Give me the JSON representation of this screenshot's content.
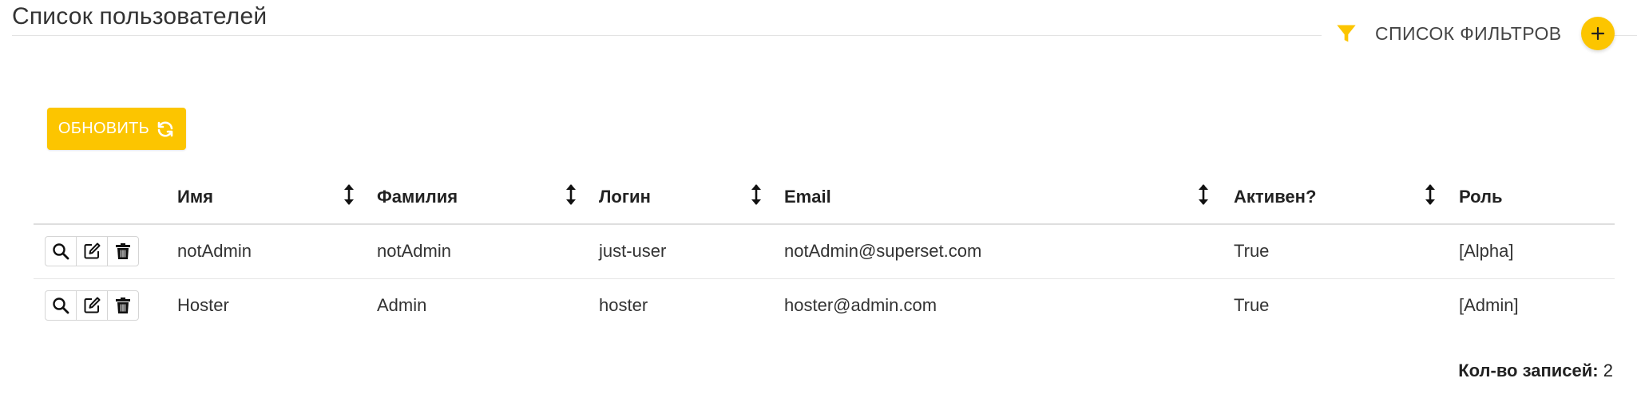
{
  "page": {
    "title": "Список пользователей"
  },
  "filters": {
    "label": "СПИСОК ФИЛЬТРОВ",
    "icon": "filter-icon",
    "add_icon": "plus-icon"
  },
  "toolbar": {
    "refresh_label": "ОБНОВИТЬ",
    "refresh_icon": "refresh-icon"
  },
  "colors": {
    "accent": "#fcc500",
    "text": "#333333",
    "border": "#dedede"
  },
  "table": {
    "columns": [
      "Имя",
      "Фамилия",
      "Логин",
      "Email",
      "Активен?",
      "Роль"
    ],
    "rows": [
      {
        "first_name": "notAdmin",
        "last_name": "notAdmin",
        "login": "just-user",
        "email": "notAdmin@superset.com",
        "active": "True",
        "role": "[Alpha]"
      },
      {
        "first_name": "Hoster",
        "last_name": "Admin",
        "login": "hoster",
        "email": "hoster@admin.com",
        "active": "True",
        "role": "[Admin]"
      }
    ],
    "row_actions": [
      "search-icon",
      "edit-icon",
      "trash-icon"
    ]
  },
  "footer": {
    "count_label": "Кол-во записей:",
    "count_value": "2"
  }
}
